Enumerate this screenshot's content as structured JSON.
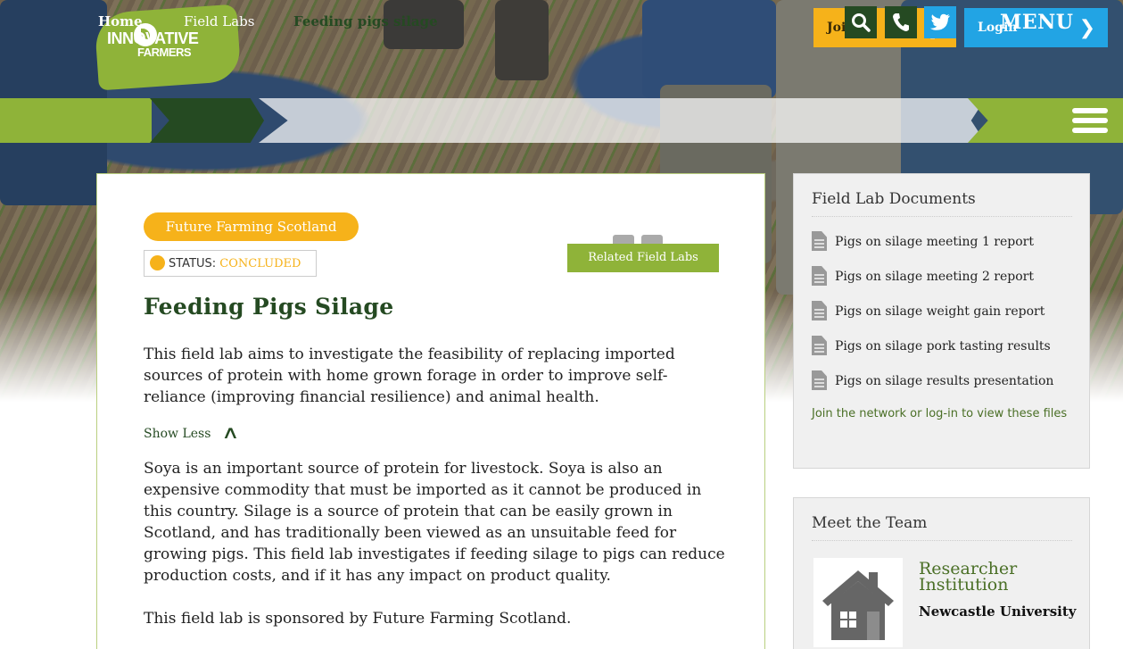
{
  "header": {
    "logo": {
      "line1": "INNOVATIVE",
      "line2": "FARMERS"
    },
    "join_label": "Join",
    "login_label": "Login"
  },
  "breadcrumb": {
    "home": "Home",
    "field_labs": "Field Labs",
    "current": "Feeding pigs silage"
  },
  "nav": {
    "menu_label": "MENU",
    "icons": [
      "search-icon",
      "phone-icon",
      "twitter-icon",
      "hamburger-icon"
    ]
  },
  "main": {
    "tag": "Future Farming Scotland",
    "status_label": "STATUS: ",
    "status_value": "CONCLUDED",
    "related_label": "Related Field Labs",
    "title": "Feeding Pigs Silage",
    "intro": "This field lab aims to investigate the feasibility of replacing imported sources of protein with home grown forage in order to improve self-reliance (improving financial resilience) and animal health.",
    "show_less": "Show Less",
    "body1": "Soya is an important source of protein for livestock. Soya is also an expensive commodity that must be imported as it cannot be produced in this country. Silage is a source of protein that can be easily grown in Scotland, and has traditionally been viewed as an unsuitable feed for growing pigs. This field lab investigates if feeding silage to pigs can reduce production costs, and if it has any impact on product quality.",
    "body2": "This field lab is sponsored by Future Farming Scotland."
  },
  "documents": {
    "title": "Field Lab Documents",
    "items": [
      "Pigs on silage meeting 1 report",
      "Pigs on silage meeting 2 report",
      "Pigs on silage weight gain report",
      "Pigs on silage pork tasting results",
      "Pigs on silage results presentation"
    ],
    "note": "Join the network or log-in to view these files"
  },
  "team": {
    "title": "Meet the Team",
    "role": "Researcher Institution",
    "name": "Newcastle University"
  },
  "colors": {
    "green": "#8fb339",
    "dark_green": "#254a22",
    "yellow": "#f6b21a",
    "blue": "#22a4e4"
  }
}
